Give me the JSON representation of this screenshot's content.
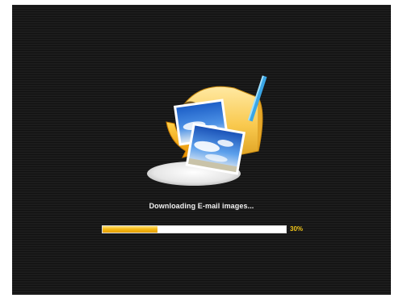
{
  "status": {
    "message": "Downloading E-mail images..."
  },
  "progress": {
    "fraction": 0.3,
    "label": "30%",
    "fill_color": "#f7bb18",
    "track_color": "#ffffff"
  },
  "illustration": {
    "icon": "mailbox-with-photos-icon",
    "accent_color": "#f5a400"
  },
  "theme": {
    "background": "#1a1a1a",
    "text_color": "#f2f2f2",
    "percent_color": "#f0c419"
  }
}
